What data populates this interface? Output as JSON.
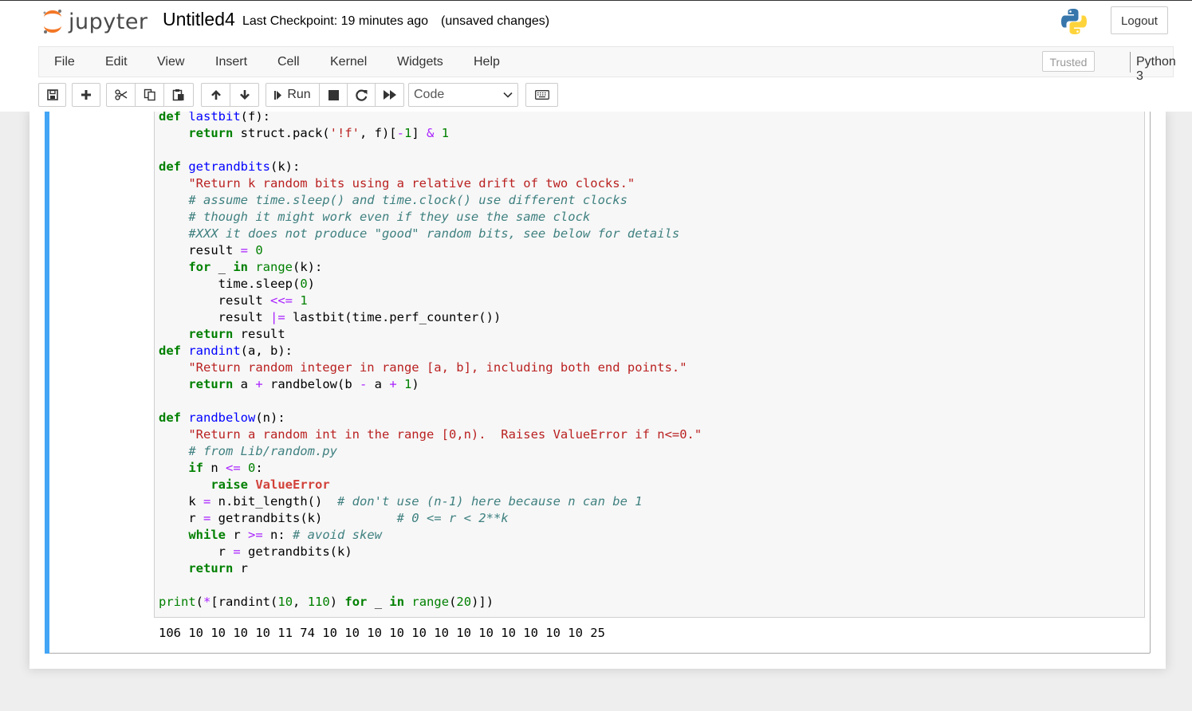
{
  "header": {
    "logo_text": "jupyter",
    "notebook_name": "Untitled4",
    "checkpoint": "Last Checkpoint: 19 minutes ago",
    "unsaved": "(unsaved changes)",
    "logout_label": "Logout"
  },
  "menu": {
    "items": [
      "File",
      "Edit",
      "View",
      "Insert",
      "Cell",
      "Kernel",
      "Widgets",
      "Help"
    ],
    "trusted_label": "Trusted",
    "kernel_name": "Python 3"
  },
  "toolbar": {
    "run_label": "Run",
    "cell_type": "Code",
    "icons": [
      "save-icon",
      "plus-icon",
      "scissors-icon",
      "copy-icon",
      "paste-icon",
      "arrow-up-icon",
      "arrow-down-icon",
      "run-icon",
      "stop-icon",
      "restart-icon",
      "fast-forward-icon",
      "keyboard-icon"
    ]
  },
  "colors": {
    "keyword": "#008000",
    "function": "#0000ff",
    "string": "#ba2121",
    "comment": "#408080",
    "operator": "#aa22ff",
    "exception": "#d2413a",
    "cell_selected_bar": "#42a5f5"
  },
  "cell": {
    "code_lines": [
      "def lastbit(f):",
      "    return struct.pack('!f', f)[-1] & 1",
      "",
      "def getrandbits(k):",
      "    \"Return k random bits using a relative drift of two clocks.\"",
      "    # assume time.sleep() and time.clock() use different clocks",
      "    # though it might work even if they use the same clock",
      "    #XXX it does not produce \"good\" random bits, see below for details",
      "    result = 0",
      "    for _ in range(k):",
      "        time.sleep(0)",
      "        result <<= 1",
      "        result |= lastbit(time.perf_counter())",
      "    return result",
      "def randint(a, b):",
      "    \"Return random integer in range [a, b], including both end points.\"",
      "    return a + randbelow(b - a + 1)",
      "",
      "def randbelow(n):",
      "    \"Return a random int in the range [0,n).  Raises ValueError if n<=0.\"",
      "    # from Lib/random.py",
      "    if n <= 0:",
      "       raise ValueError",
      "    k = n.bit_length()  # don't use (n-1) here because n can be 1",
      "    r = getrandbits(k)          # 0 <= r < 2**k",
      "    while r >= n: # avoid skew",
      "        r = getrandbits(k)",
      "    return r",
      "",
      "print(*[randint(10, 110) for _ in range(20)])"
    ],
    "output": "106 10 10 10 10 11 74 10 10 10 10 10 10 10 10 10 10 10 10 25"
  }
}
